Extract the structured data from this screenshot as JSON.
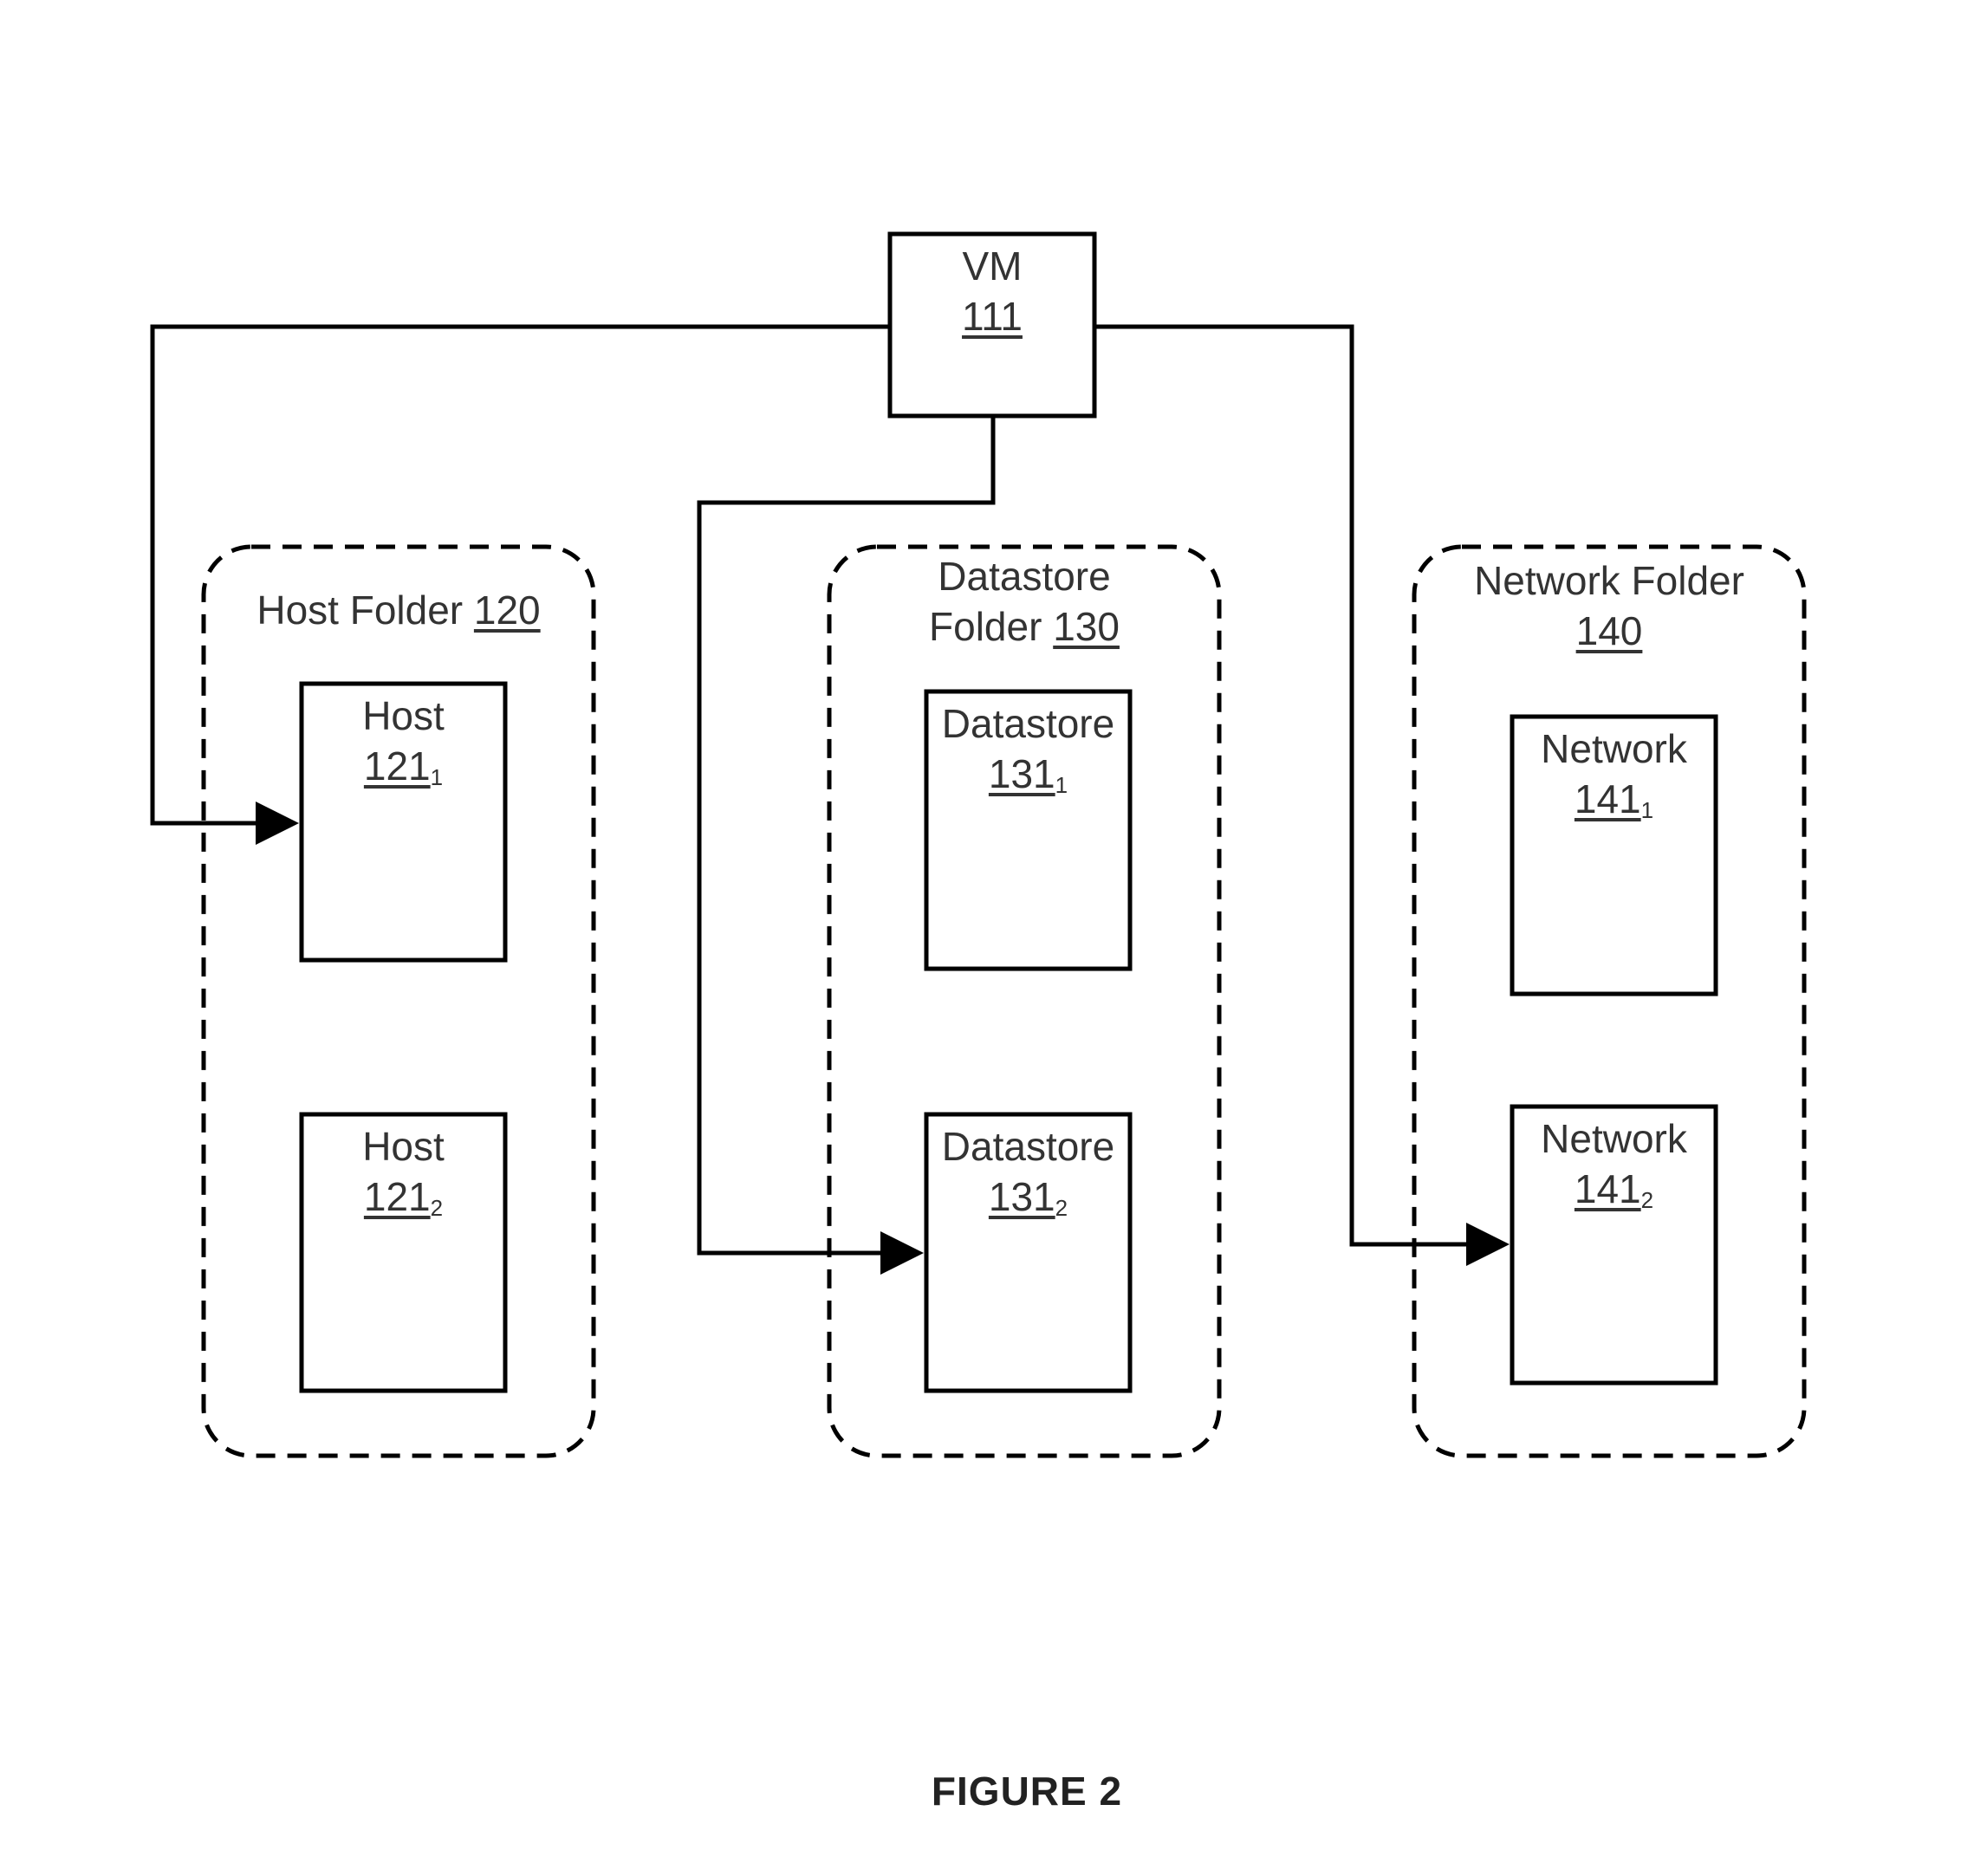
{
  "figure_caption": "FIGURE 2",
  "vm": {
    "name": "VM",
    "ref": "111"
  },
  "folders": [
    {
      "name_line1": "Host Folder",
      "ref": "120",
      "items": [
        {
          "name": "Host",
          "ref": "121",
          "sub": "1"
        },
        {
          "name": "Host",
          "ref": "121",
          "sub": "2"
        }
      ]
    },
    {
      "name_line1": "Datastore",
      "name_line2": "Folder",
      "ref": "130",
      "items": [
        {
          "name": "Datastore",
          "ref": "131",
          "sub": "1"
        },
        {
          "name": "Datastore",
          "ref": "131",
          "sub": "2"
        }
      ]
    },
    {
      "name_line1": "Network Folder",
      "ref": "140",
      "items": [
        {
          "name": "Network",
          "ref": "141",
          "sub": "1"
        },
        {
          "name": "Network",
          "ref": "141",
          "sub": "2"
        }
      ]
    }
  ],
  "connections": [
    {
      "from": "VM 111",
      "to": "Host 121_1"
    },
    {
      "from": "VM 111",
      "to": "Datastore 131_2"
    },
    {
      "from": "VM 111",
      "to": "Network 141_2"
    }
  ]
}
